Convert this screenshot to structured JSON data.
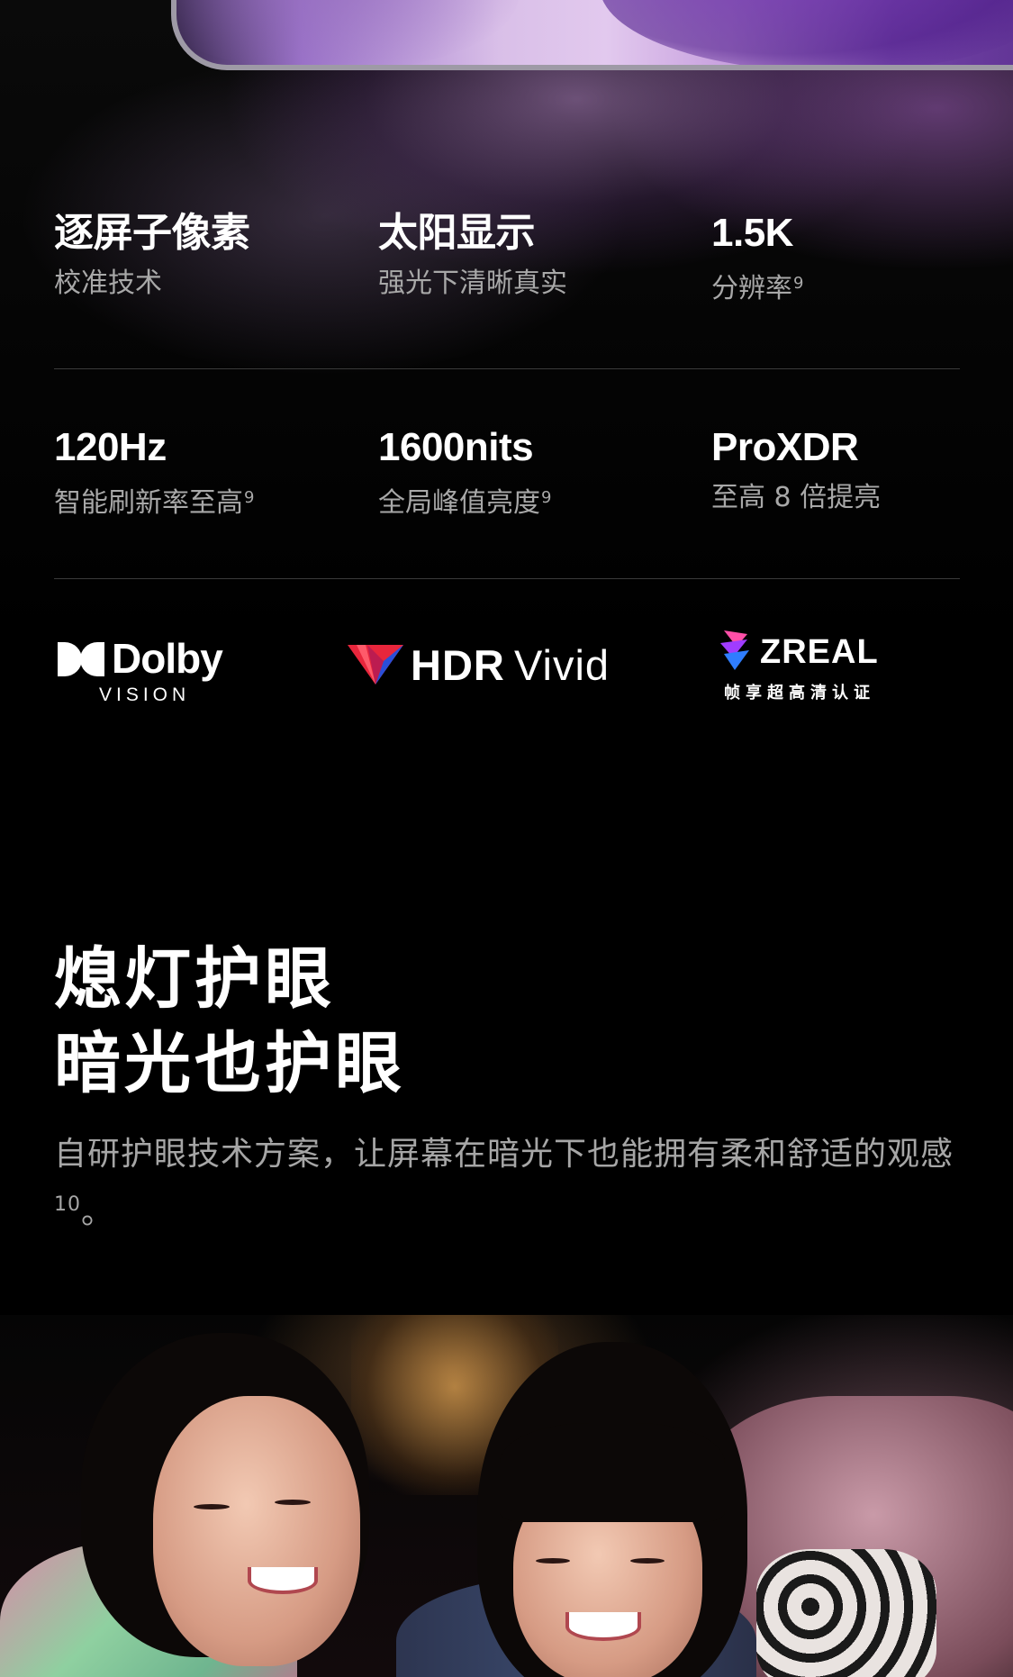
{
  "specs": [
    {
      "title": "逐屏子像素",
      "sub": "校准技术",
      "sup": ""
    },
    {
      "title": "太阳显示",
      "sub": "强光下清晰真实",
      "sup": ""
    },
    {
      "title": "1.5K",
      "sub": "分辨率",
      "sup": "9"
    },
    {
      "title": "120Hz",
      "sub": "智能刷新率至高",
      "sup": "9"
    },
    {
      "title": "1600nits",
      "sub": "全局峰值亮度",
      "sup": "9"
    },
    {
      "title": "ProXDR",
      "sub": "至高 8 倍提亮",
      "sup": ""
    }
  ],
  "logos": {
    "dolby": {
      "word": "Dolby",
      "sub": "VISION"
    },
    "hdr_vivid": {
      "hdr": "HDR",
      "vivid": "Vivid"
    },
    "zreal": {
      "word": "ZREAL",
      "sub": "帧享超高清认证"
    }
  },
  "section": {
    "headline_line1": "熄灯护眼",
    "headline_line2": "暗光也护眼",
    "description": "自研护眼技术方案，让屏幕在暗光下也能拥有柔和舒适的观感",
    "description_sup": "10",
    "description_end": "。"
  },
  "colors": {
    "background": "#000000",
    "subtext": "#a8a8a8",
    "accent_purple": "#9a72c8",
    "hdr_red": "#e8263c",
    "hdr_blue": "#2a4fd8"
  },
  "icons": [
    "dolby-double-d-icon",
    "hdr-vivid-triangle-icon",
    "zreal-prism-icon"
  ]
}
